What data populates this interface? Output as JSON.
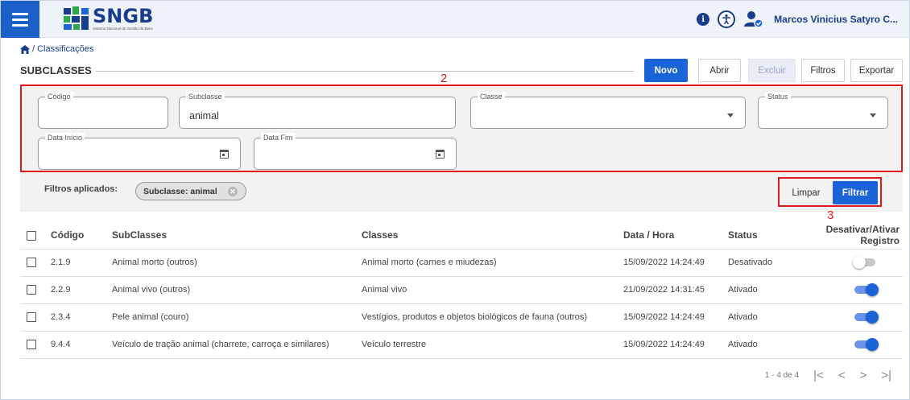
{
  "header": {
    "logo_text": "SNGB",
    "logo_subtitle": "Sistema Nacional de Gestão de Bens",
    "user_name": "Marcos Vinicius Satyro C...",
    "info_icon": "i",
    "accessibility_icon": "♿"
  },
  "breadcrumb": {
    "home_icon": "home-icon",
    "text": "/ Classificações"
  },
  "page": {
    "title": "SUBCLASSES"
  },
  "toolbar": {
    "novo_label": "Novo",
    "abrir_label": "Abrir",
    "excluir_label": "Excluir",
    "filtros_label": "Filtros",
    "exportar_label": "Exportar"
  },
  "annotations": {
    "filters_box": "2",
    "actions_box": "3"
  },
  "filters": {
    "codigo": {
      "label": "Código",
      "value": ""
    },
    "subclasse": {
      "label": "Subclasse",
      "value": "animal"
    },
    "classe": {
      "label": "Classe",
      "value": ""
    },
    "status": {
      "label": "Status",
      "value": ""
    },
    "data_inicio": {
      "label": "Data Início",
      "value": ""
    },
    "data_fim": {
      "label": "Data Fim",
      "value": ""
    }
  },
  "applied": {
    "label": "Filtros aplicados:",
    "chip": "Subclasse: animal"
  },
  "actions": {
    "limpar_label": "Limpar",
    "filtrar_label": "Filtrar"
  },
  "table": {
    "columns": [
      "Código",
      "SubClasses",
      "Classes",
      "Data / Hora",
      "Status",
      "Desativar/Ativar Registro"
    ],
    "rows": [
      {
        "codigo": "2.1.9",
        "subclasse": "Animal morto (outros)",
        "classe": "Animal morto (carnes e miudezas)",
        "data": "15/09/2022 14:24:49",
        "status": "Desativado",
        "active": false
      },
      {
        "codigo": "2.2.9",
        "subclasse": "Animal vivo (outros)",
        "classe": "Animal vivo",
        "data": "21/09/2022 14:31:45",
        "status": "Ativado",
        "active": true
      },
      {
        "codigo": "2.3.4",
        "subclasse": "Pele animal (couro)",
        "classe": "Vestígios, produtos e objetos biológicos de fauna (outros)",
        "data": "15/09/2022 14:24:49",
        "status": "Ativado",
        "active": true
      },
      {
        "codigo": "9.4.4",
        "subclasse": "Veículo de tração animal (charrete, carroça e similares)",
        "classe": "Veículo terrestre",
        "data": "15/09/2022 14:24:49",
        "status": "Ativado",
        "active": true
      }
    ]
  },
  "pagination": {
    "range": "1 - 4 de 4"
  },
  "colors": {
    "primary": "#1b64d8",
    "brand_dark": "#1a3c8c",
    "annotation": "#e0191e"
  }
}
